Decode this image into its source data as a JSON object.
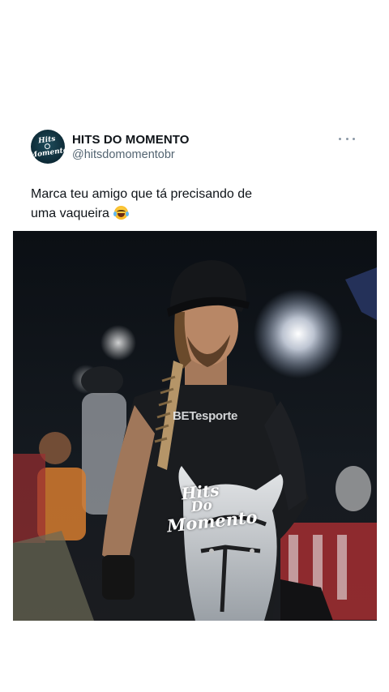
{
  "post": {
    "author": {
      "display_name": "HITS DO MOMENTO",
      "handle": "@hitsdomomentobr",
      "avatar_text": "Hits Do Momento"
    },
    "text_line1": "Marca teu amigo que tá precisando de",
    "text_line2": "uma vaqueira",
    "emoji": "face-with-tears-of-joy",
    "media": {
      "shirt_text": "BETesporte",
      "watermark": {
        "line1": "Hits",
        "line2": "Do",
        "line3": "Momento"
      }
    }
  },
  "colors": {
    "text_primary": "#0f1419",
    "text_secondary": "#536471",
    "background": "#ffffff",
    "media_dark": "#101419"
  },
  "icons": [
    "more-options-icon",
    "laughing-emoji-icon"
  ]
}
